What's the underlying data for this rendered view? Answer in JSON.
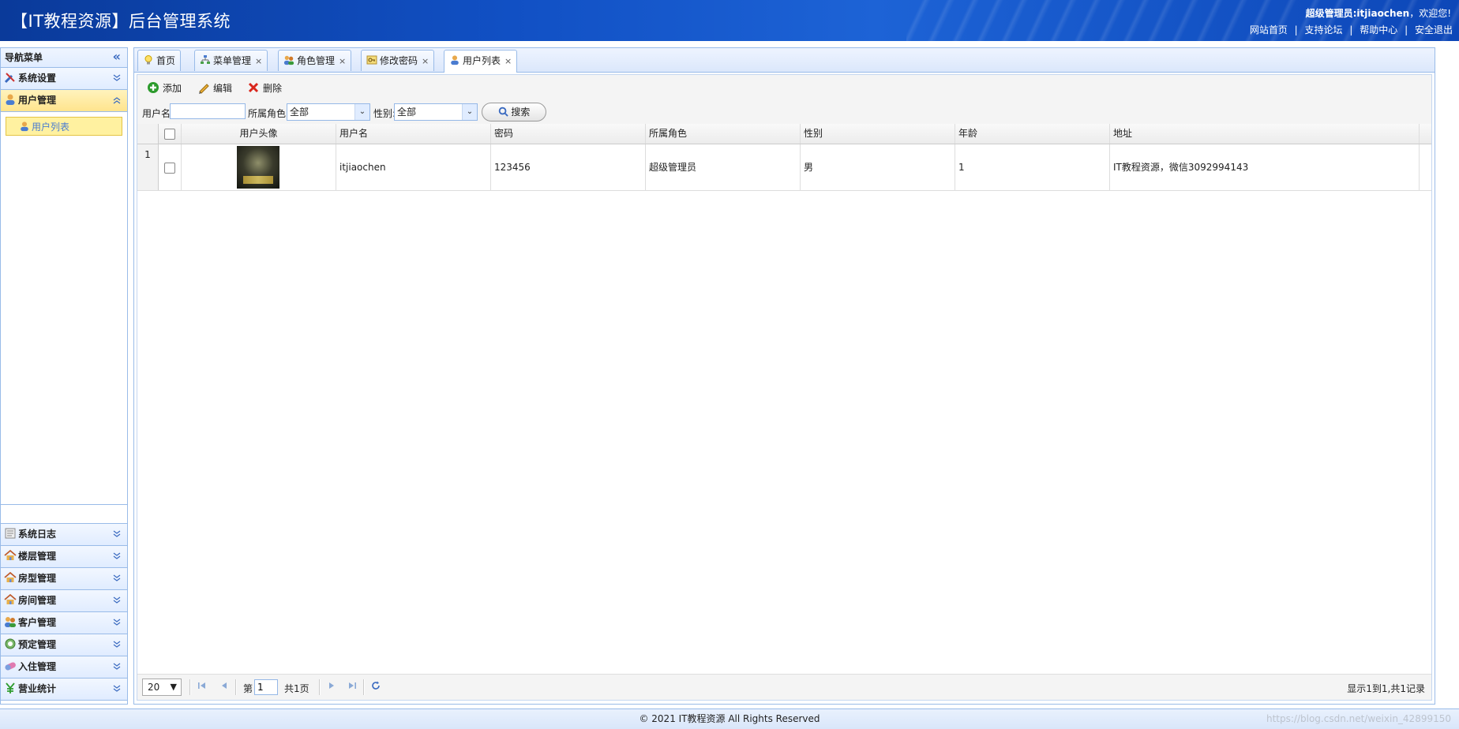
{
  "header": {
    "title": "【IT教程资源】后台管理系统",
    "welcome_user": "超级管理员:itjiaochen",
    "welcome_suffix": "，欢迎您!",
    "links": [
      "网站首页",
      "支持论坛",
      "帮助中心",
      "安全退出"
    ],
    "link_sep": "|"
  },
  "sidebar": {
    "title": "导航菜单",
    "collapse_glyph": "«",
    "expand_glyph": "»",
    "panels_top": [
      {
        "label": "系统设置",
        "icon": "wrench-icon",
        "state": "collapsed"
      },
      {
        "label": "用户管理",
        "icon": "user-icon",
        "state": "expanded"
      }
    ],
    "sub_items": [
      {
        "label": "用户列表",
        "icon": "user-icon"
      }
    ],
    "panels_bottom": [
      {
        "label": "系统日志",
        "icon": "log-icon"
      },
      {
        "label": "楼层管理",
        "icon": "house-icon"
      },
      {
        "label": "房型管理",
        "icon": "house-icon"
      },
      {
        "label": "房间管理",
        "icon": "house-icon"
      },
      {
        "label": "客户管理",
        "icon": "users-icon"
      },
      {
        "label": "预定管理",
        "icon": "clock-icon"
      },
      {
        "label": "入住管理",
        "icon": "pill-icon"
      },
      {
        "label": "营业统计",
        "icon": "yen-icon"
      }
    ]
  },
  "tabs": [
    {
      "label": "首页",
      "icon": "bulb-icon",
      "closable": false
    },
    {
      "label": "菜单管理",
      "icon": "tree-icon",
      "closable": true
    },
    {
      "label": "角色管理",
      "icon": "users-icon",
      "closable": true
    },
    {
      "label": "修改密码",
      "icon": "key-icon",
      "closable": true
    },
    {
      "label": "用户列表",
      "icon": "user-icon",
      "closable": true,
      "active": true
    }
  ],
  "tab_close": "×",
  "toolbar": {
    "add": "添加",
    "edit": "编辑",
    "delete": "删除"
  },
  "search": {
    "username_label": "用户名:",
    "username_value": "",
    "role_label": "所属角色:",
    "role_value": "全部",
    "gender_label": "性别:",
    "gender_value": "全部",
    "search_button": "搜索",
    "arrow_glyph": "⌄"
  },
  "grid": {
    "columns": [
      "用户头像",
      "用户名",
      "密码",
      "所属角色",
      "性别",
      "年龄",
      "地址"
    ],
    "rows": [
      {
        "num": "1",
        "username": "itjiaochen",
        "password": "123456",
        "role": "超级管理员",
        "gender": "男",
        "age": "1",
        "address": "IT教程资源，微信3092994143"
      }
    ]
  },
  "pager": {
    "page_size": "20",
    "page_label_prefix": "第",
    "page_value": "1",
    "page_total": "共1页",
    "summary": "显示1到1,共1记录",
    "first_glyph": "⏮",
    "prev_glyph": "◀",
    "next_glyph": "▶",
    "last_glyph": "⏭",
    "refresh_glyph": "↻",
    "dropdown_glyph": "▼"
  },
  "footer": {
    "text": "© 2021 IT教程资源 All Rights Reserved",
    "watermark": "https://blog.csdn.net/weixin_42899150"
  },
  "colors": {
    "header_bg": "#1150c4",
    "active_panel": "#ffe48d",
    "border": "#99bbe8"
  }
}
